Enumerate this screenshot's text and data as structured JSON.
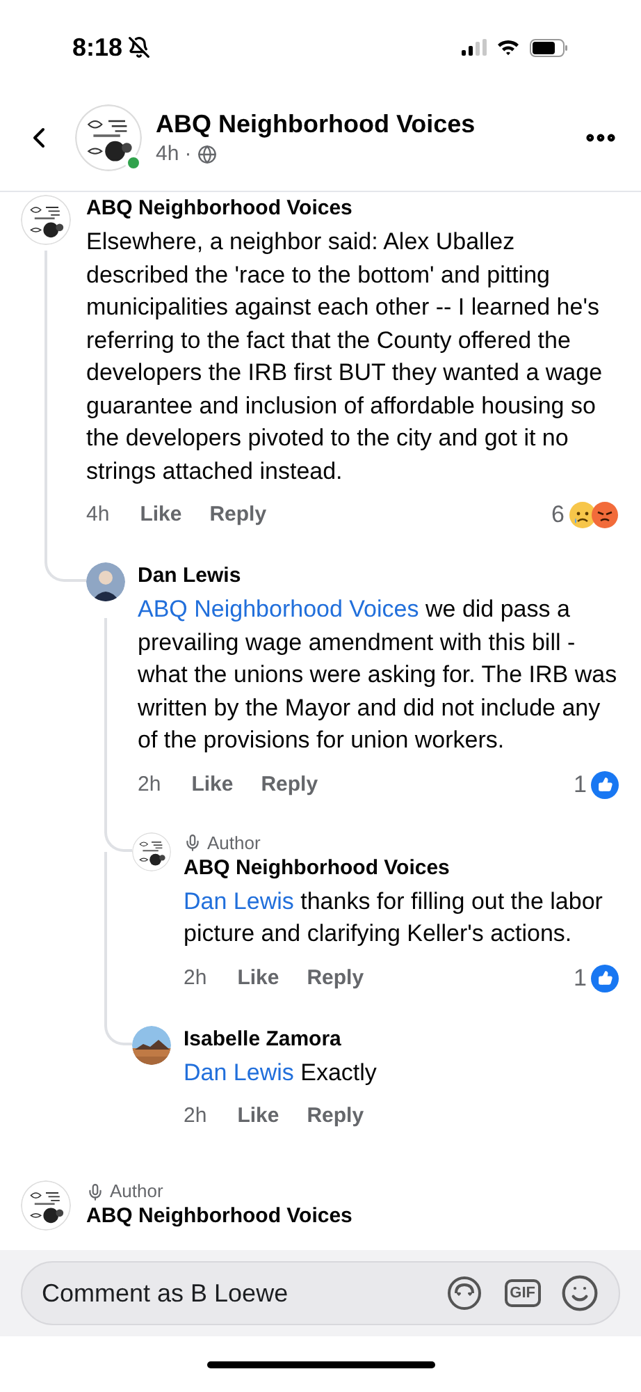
{
  "status_bar": {
    "time": "8:18",
    "silent": true
  },
  "header": {
    "title": "ABQ Neighborhood Voices",
    "time": "4h",
    "separator": "·",
    "online": true
  },
  "comments": [
    {
      "author": "ABQ Neighborhood Voices",
      "avatar": {
        "kind": "group"
      },
      "text": "Elsewhere, a neighbor said: Alex Uballez described the 'race to the bottom' and pitting municipalities against each other -- I learned he's referring to the fact that the County offered the developers the IRB first BUT they wanted a wage guarantee and inclusion of affordable housing so the developers pivoted to the city and got it no strings attached instead.",
      "time": "4h",
      "like": "Like",
      "reply": "Reply",
      "reactions": {
        "count": "6",
        "icons": [
          {
            "kind": "sad"
          },
          {
            "kind": "angry"
          }
        ]
      },
      "replies": [
        {
          "author": "Dan Lewis",
          "avatar": {
            "kind": "person"
          },
          "mention": "ABQ Neighborhood Voices",
          "text": "we did pass a prevailing wage amendment with this bill - what the unions were asking for.  The IRB was written by the Mayor and did not include any of the provisions for union workers.",
          "time": "2h",
          "like": "Like",
          "reply": "Reply",
          "reactions": {
            "count": "1",
            "icons": [
              {
                "kind": "like"
              }
            ]
          },
          "replies": [
            {
              "badge": "Author",
              "author": "ABQ Neighborhood Voices",
              "avatar": {
                "kind": "group"
              },
              "mention": "Dan Lewis",
              "text": "thanks for filling out the labor picture and clarifying Keller's actions.",
              "time": "2h",
              "like": "Like",
              "reply": "Reply",
              "reactions": {
                "count": "1",
                "icons": [
                  {
                    "kind": "like"
                  }
                ]
              }
            },
            {
              "author": "Isabelle Zamora",
              "mention": "Dan Lewis",
              "text": "Exactly",
              "time": "2h",
              "like": "Like",
              "reply": "Reply"
            }
          ]
        }
      ]
    },
    {
      "badge": "Author",
      "author": "ABQ Neighborhood Voices",
      "avatar": {
        "kind": "group"
      }
    }
  ],
  "composer": {
    "placeholder": "Comment as B Loewe",
    "gif": "GIF"
  }
}
